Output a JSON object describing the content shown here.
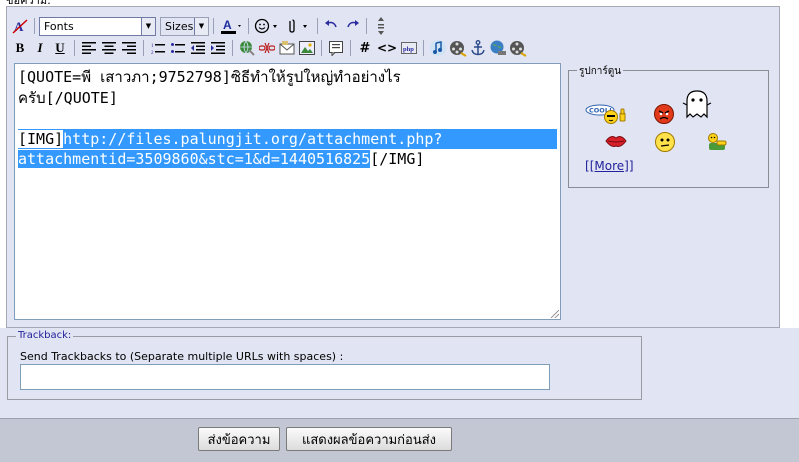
{
  "section_label": "ข้อความ:",
  "toolbar": {
    "font_combo": "Fonts",
    "size_combo": "Sizes",
    "bold": "B",
    "italic": "I",
    "underline": "U",
    "wrap_code": "#",
    "wrap_html": "<>"
  },
  "editor": {
    "line1": "[QUOTE=พี เสาวภา;9752798]ซิธีทำให้รูปใหญ่ทำอย่างไร",
    "line2": "ครับ[/QUOTE]",
    "img_open": "[IMG]",
    "url_part1": "http://files.palungjit.org/attachment.php?",
    "url_part2": "attachmentid=3509860&stc=1&d=1440516825",
    "img_close": "[/IMG]"
  },
  "smilies": {
    "legend": "รูปการ์ตูน",
    "cool_text": "COOL!",
    "more_label": "[More]"
  },
  "trackback": {
    "legend": "Trackback:",
    "label": "Send Trackbacks to (Separate multiple URLs with spaces) :",
    "value": ""
  },
  "buttons": {
    "submit": "ส่งข้อความ",
    "preview": "แสดงผลข้อความก่อนส่ง"
  },
  "colors": {
    "panel_bg": "#e1e4f2",
    "selection": "#3399ff",
    "link": "#22229c"
  }
}
